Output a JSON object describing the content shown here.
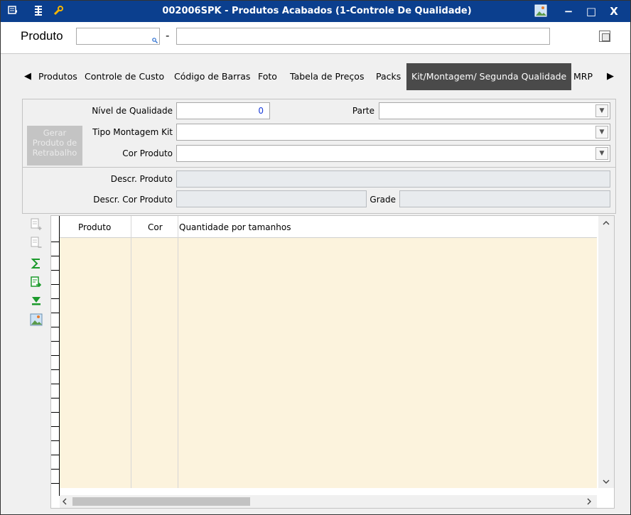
{
  "window": {
    "title": "002006SPK - Produtos Acabados (1-Controle De Qualidade)",
    "min_label": "−",
    "max_label": "□",
    "close_label": "X"
  },
  "produto": {
    "label": "Produto",
    "code_value": "",
    "separator": "-",
    "description_value": ""
  },
  "tabs": {
    "left_arrow": "◀",
    "right_arrow": "▶",
    "items": [
      "Produtos",
      "Controle de Custo",
      "Código de Barras",
      "Foto",
      "Tabela de Preços",
      "Packs",
      "Kit/Montagem/ Segunda Qualidade",
      "MRP"
    ],
    "active": "Kit/Montagem/ Segunda Qualidade"
  },
  "form": {
    "nivel_label": "Nível de Qualidade",
    "nivel_value": "0",
    "parte_label": "Parte",
    "tipo_label": "Tipo Montagem Kit",
    "cor_label": "Cor Produto",
    "gerar_label": "Gerar Produto de Retrabalho",
    "descr_label": "Descr. Produto",
    "descr_cor_label": "Descr. Cor Produto",
    "grade_label": "Grade"
  },
  "grid": {
    "columns": [
      "Produto",
      "Cor",
      "Quantidade por tamanhos"
    ],
    "rows": []
  },
  "icons": {
    "title_left": [
      "window-menu-icon",
      "tree-icon",
      "wrench-icon"
    ],
    "title_right": "picture-icon",
    "tools": [
      "add-row-icon",
      "remove-row-icon",
      "sum-icon",
      "export-icon",
      "move-bottom-icon",
      "image-icon"
    ]
  },
  "colors": {
    "titlebar": "#0b3f8e",
    "active_tab": "#4a4a4a",
    "grid_body": "#fcf3dd",
    "value_blue": "#1a3cd9"
  }
}
